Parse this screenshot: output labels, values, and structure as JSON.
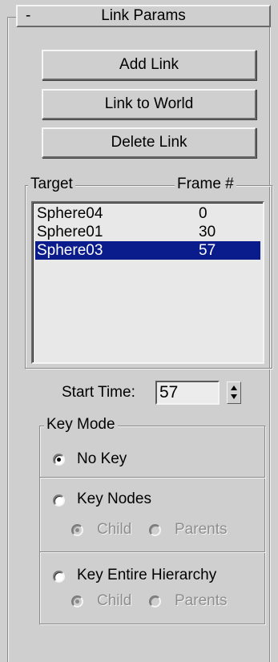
{
  "rollout": {
    "collapse_sign": "-",
    "title": "Link Params"
  },
  "buttons": {
    "add_link": "Add Link",
    "link_to_world": "Link to World",
    "delete_link": "Delete Link"
  },
  "link_list": {
    "col_target": "Target",
    "col_frame": "Frame #",
    "rows": [
      {
        "target": "Sphere04",
        "frame": "0",
        "selected": false
      },
      {
        "target": "Sphere01",
        "frame": "30",
        "selected": false
      },
      {
        "target": "Sphere03",
        "frame": "57",
        "selected": true
      }
    ]
  },
  "start_time": {
    "label": "Start Time:",
    "value": "57"
  },
  "key_mode": {
    "title": "Key Mode",
    "no_key": "No Key",
    "key_nodes": "Key Nodes",
    "key_entire_hierarchy": "Key Entire Hierarchy",
    "child": "Child",
    "parents": "Parents",
    "selected": "No Key"
  },
  "colors": {
    "panel_bg": "#cfcfcf",
    "selection": "#0a1b8c",
    "disabled_text": "#8e8e8e"
  }
}
